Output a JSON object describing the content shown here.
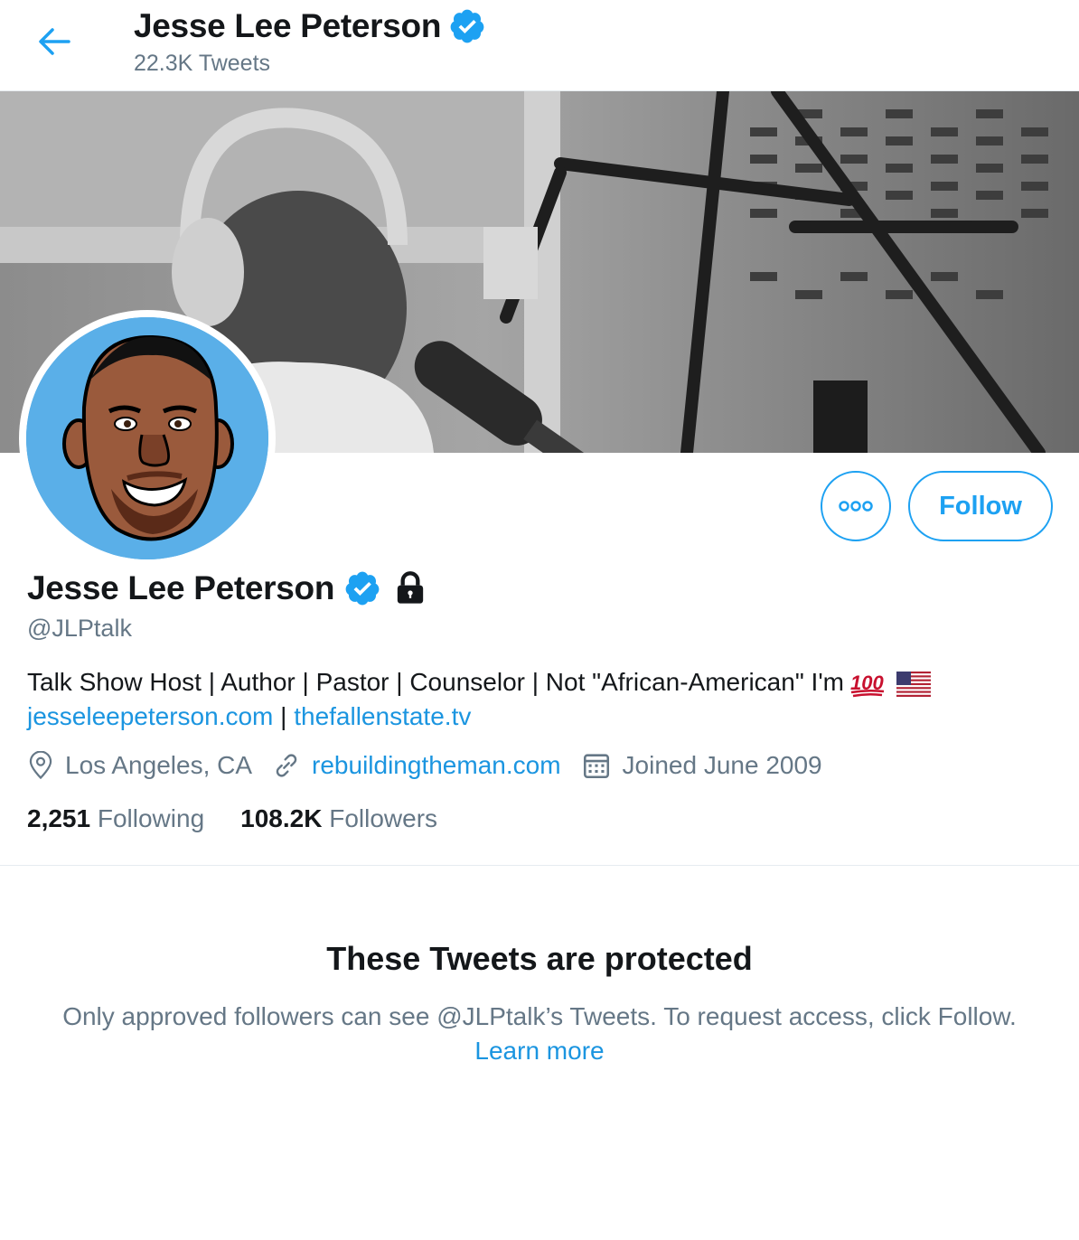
{
  "header": {
    "name": "Jesse Lee Peterson",
    "tweet_count": "22.3K Tweets"
  },
  "profile": {
    "name": "Jesse Lee Peterson",
    "handle": "@JLPtalk",
    "bio_text": "Talk Show Host | Author | Pastor | Counselor | Not \"African-American\" I'm",
    "bio_emojis": [
      "hundred-points-icon",
      "us-flag-icon"
    ],
    "bio_link_1": "jesseleepeterson.com",
    "bio_separator": " | ",
    "bio_link_2": "thefallenstate.tv",
    "location": "Los Angeles, CA",
    "website": "rebuildingtheman.com",
    "joined": "Joined June 2009",
    "following_count": "2,251",
    "following_label": "Following",
    "followers_count": "108.2K",
    "followers_label": "Followers",
    "verified": true,
    "protected": true
  },
  "actions": {
    "follow_label": "Follow",
    "more_icon": "more-icon"
  },
  "protected_notice": {
    "title": "These Tweets are protected",
    "text": "Only approved followers can see @JLPtalk’s Tweets. To request access, click Follow.",
    "link": "Learn more"
  },
  "colors": {
    "accent": "#1da1f2",
    "link": "#1b95e0",
    "secondary_text": "#657786",
    "primary_text": "#14171a"
  }
}
